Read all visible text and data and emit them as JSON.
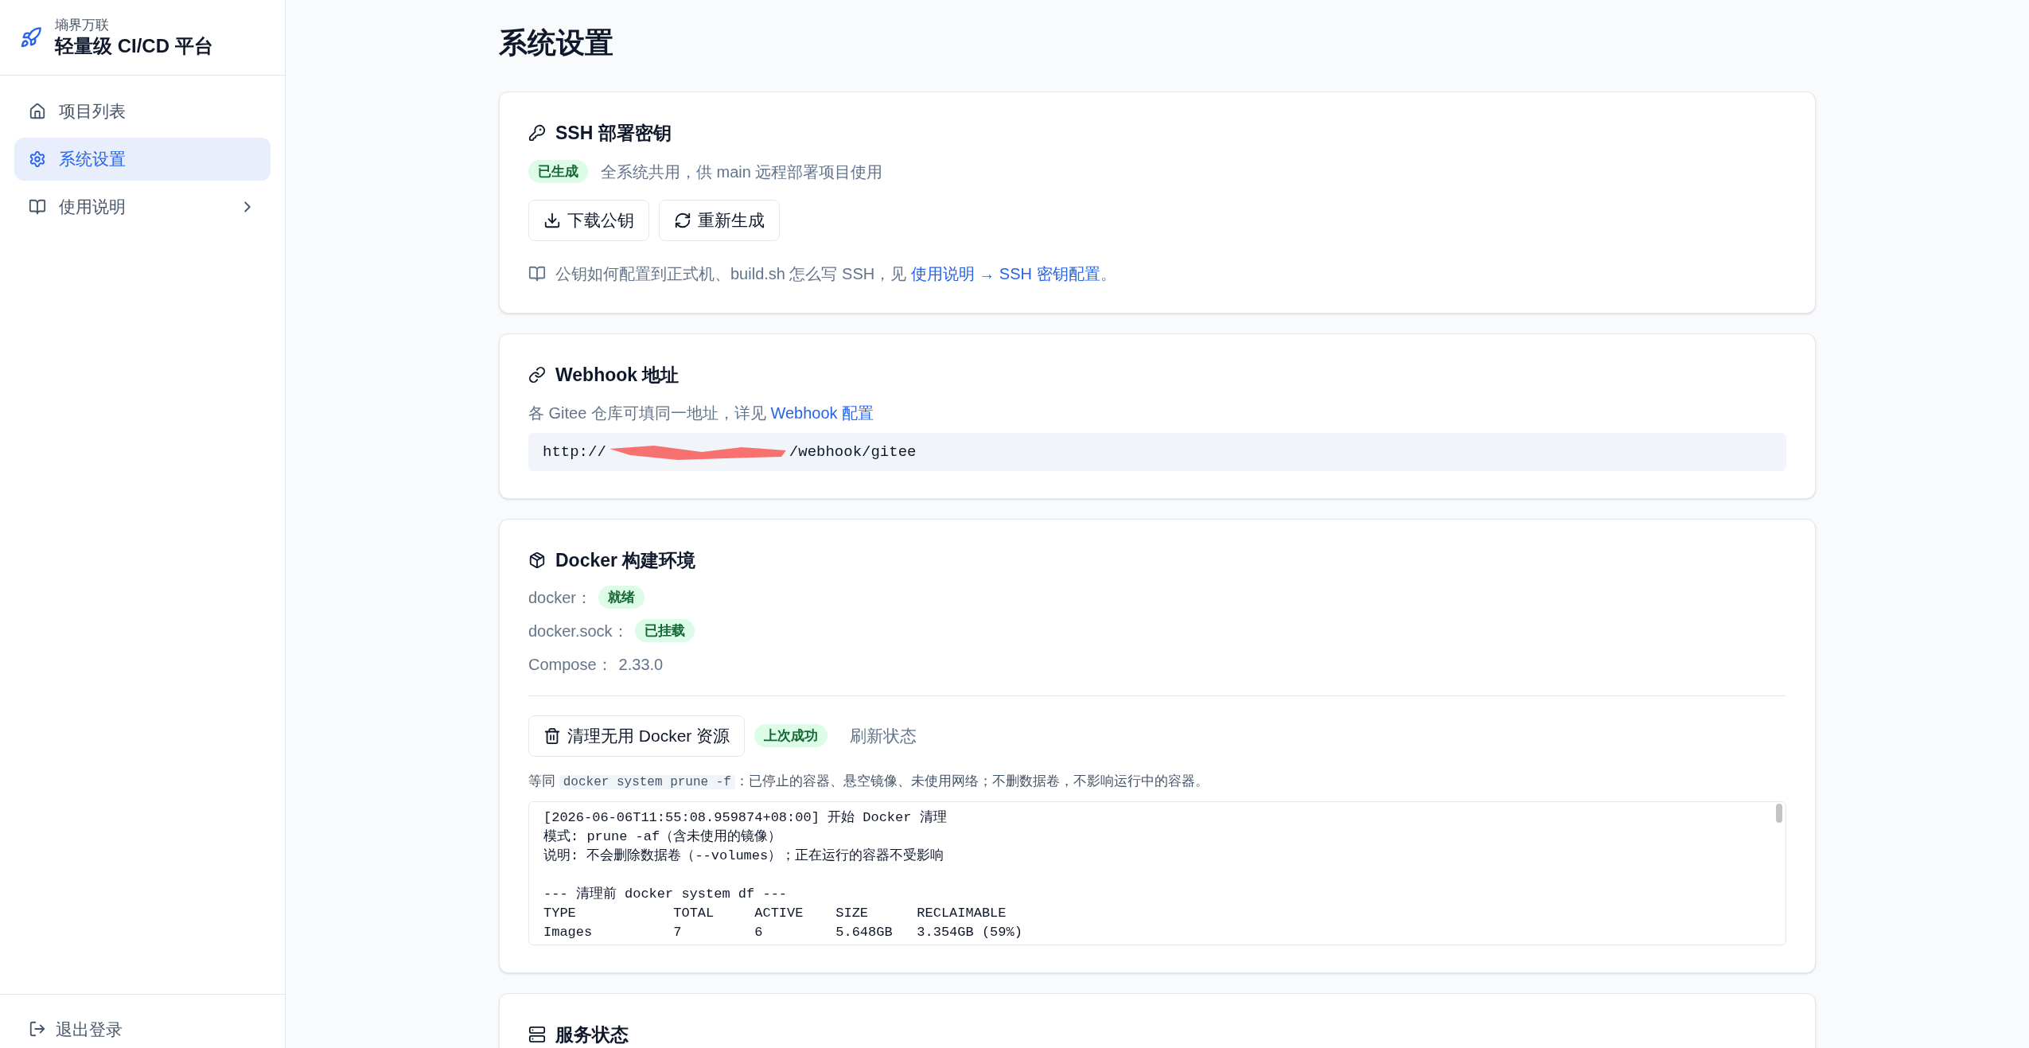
{
  "brand": {
    "company": "墒界万联",
    "product": "轻量级 CI/CD 平台"
  },
  "nav": [
    {
      "label": "项目列表",
      "selected": false,
      "kind": "link"
    },
    {
      "label": "系统设置",
      "selected": true,
      "kind": "link"
    },
    {
      "label": "使用说明",
      "selected": false,
      "kind": "group"
    }
  ],
  "logout": "退出登录",
  "page_title": "系统设置",
  "ssh": {
    "title": "SSH 部署密钥",
    "status": "已生成",
    "description": "全系统共用，供 main 远程部署项目使用",
    "buttons": [
      {
        "label": "下载公钥",
        "kind": "download"
      },
      {
        "label": "重新生成",
        "kind": "refresh"
      }
    ],
    "help_text": "公钥如何配置到正式机、build.sh 怎么写 SSH，见 ",
    "help_link": "使用说明 → SSH 密钥配置",
    "help_end": "。"
  },
  "webhook": {
    "title": "Webhook 地址",
    "description": "各 Gitee 仓库可填同一地址，详见 ",
    "link": "Webhook 配置",
    "url_prefix": "http://",
    "url_redacted": true,
    "url_suffix": "/webhook/gitee"
  },
  "docker": {
    "title": "Docker 构建环境",
    "status": [
      {
        "label": "docker：",
        "kind": "badge",
        "value": "就绪"
      },
      {
        "label": "docker.sock：",
        "kind": "badge",
        "value": "已挂载"
      },
      {
        "label": "Compose：",
        "kind": "text",
        "value": "2.33.0"
      }
    ],
    "clean_button": "清理无用 Docker 资源",
    "last_result": "上次成功",
    "refresh": "刷新状态",
    "hint_before": "等同 ",
    "hint_code": "docker system prune -f",
    "hint_after": "：已停止的容器、悬空镜像、未使用网络；不删数据卷，不影响运行中的容器。",
    "log_blocks": [
      [
        "[2026-06-06T11:55:08.959874+08:00] 开始 Docker 清理",
        "模式: prune -af（含未使用的镜像）",
        "说明: 不会删除数据卷（--volumes）；正在运行的容器不受影响"
      ],
      [
        "--- 清理前 docker system df ---",
        "TYPE            TOTAL     ACTIVE    SIZE      RECLAIMABLE",
        "Images          7         6         5.648GB   3.354GB (59%)"
      ]
    ]
  },
  "service": {
    "title": "服务状态"
  }
}
